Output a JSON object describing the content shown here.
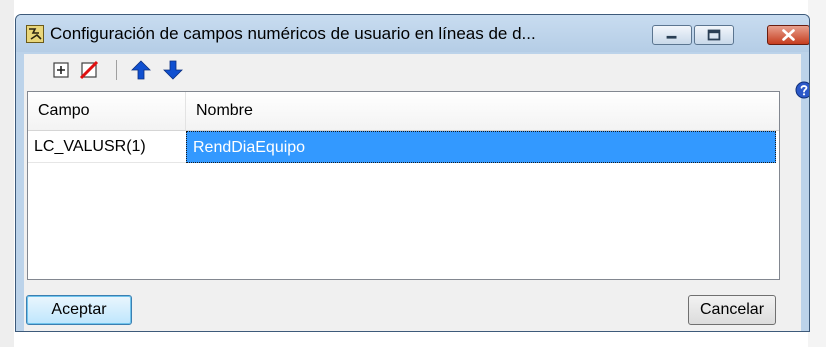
{
  "window": {
    "title": "Configuración de campos numéricos de usuario en líneas de d..."
  },
  "toolbar": {
    "buttons": [
      {
        "name": "add-row",
        "icon": "add-row-icon"
      },
      {
        "name": "delete-row",
        "icon": "delete-row-icon"
      },
      {
        "name": "move-up",
        "icon": "arrow-up-icon"
      },
      {
        "name": "move-down",
        "icon": "arrow-down-icon"
      }
    ]
  },
  "grid": {
    "columns": [
      "Campo",
      "Nombre"
    ],
    "rows": [
      {
        "campo": "LC_VALUSR(1)",
        "nombre": "RendDiaEquipo"
      }
    ]
  },
  "buttons": {
    "accept_label": "Aceptar",
    "cancel_label": "Cancelar"
  },
  "colors": {
    "selection": "#3399ff",
    "titlebar": "#bcd3ea",
    "close_button": "#c63d1f",
    "arrow_blue": "#1050d0"
  }
}
